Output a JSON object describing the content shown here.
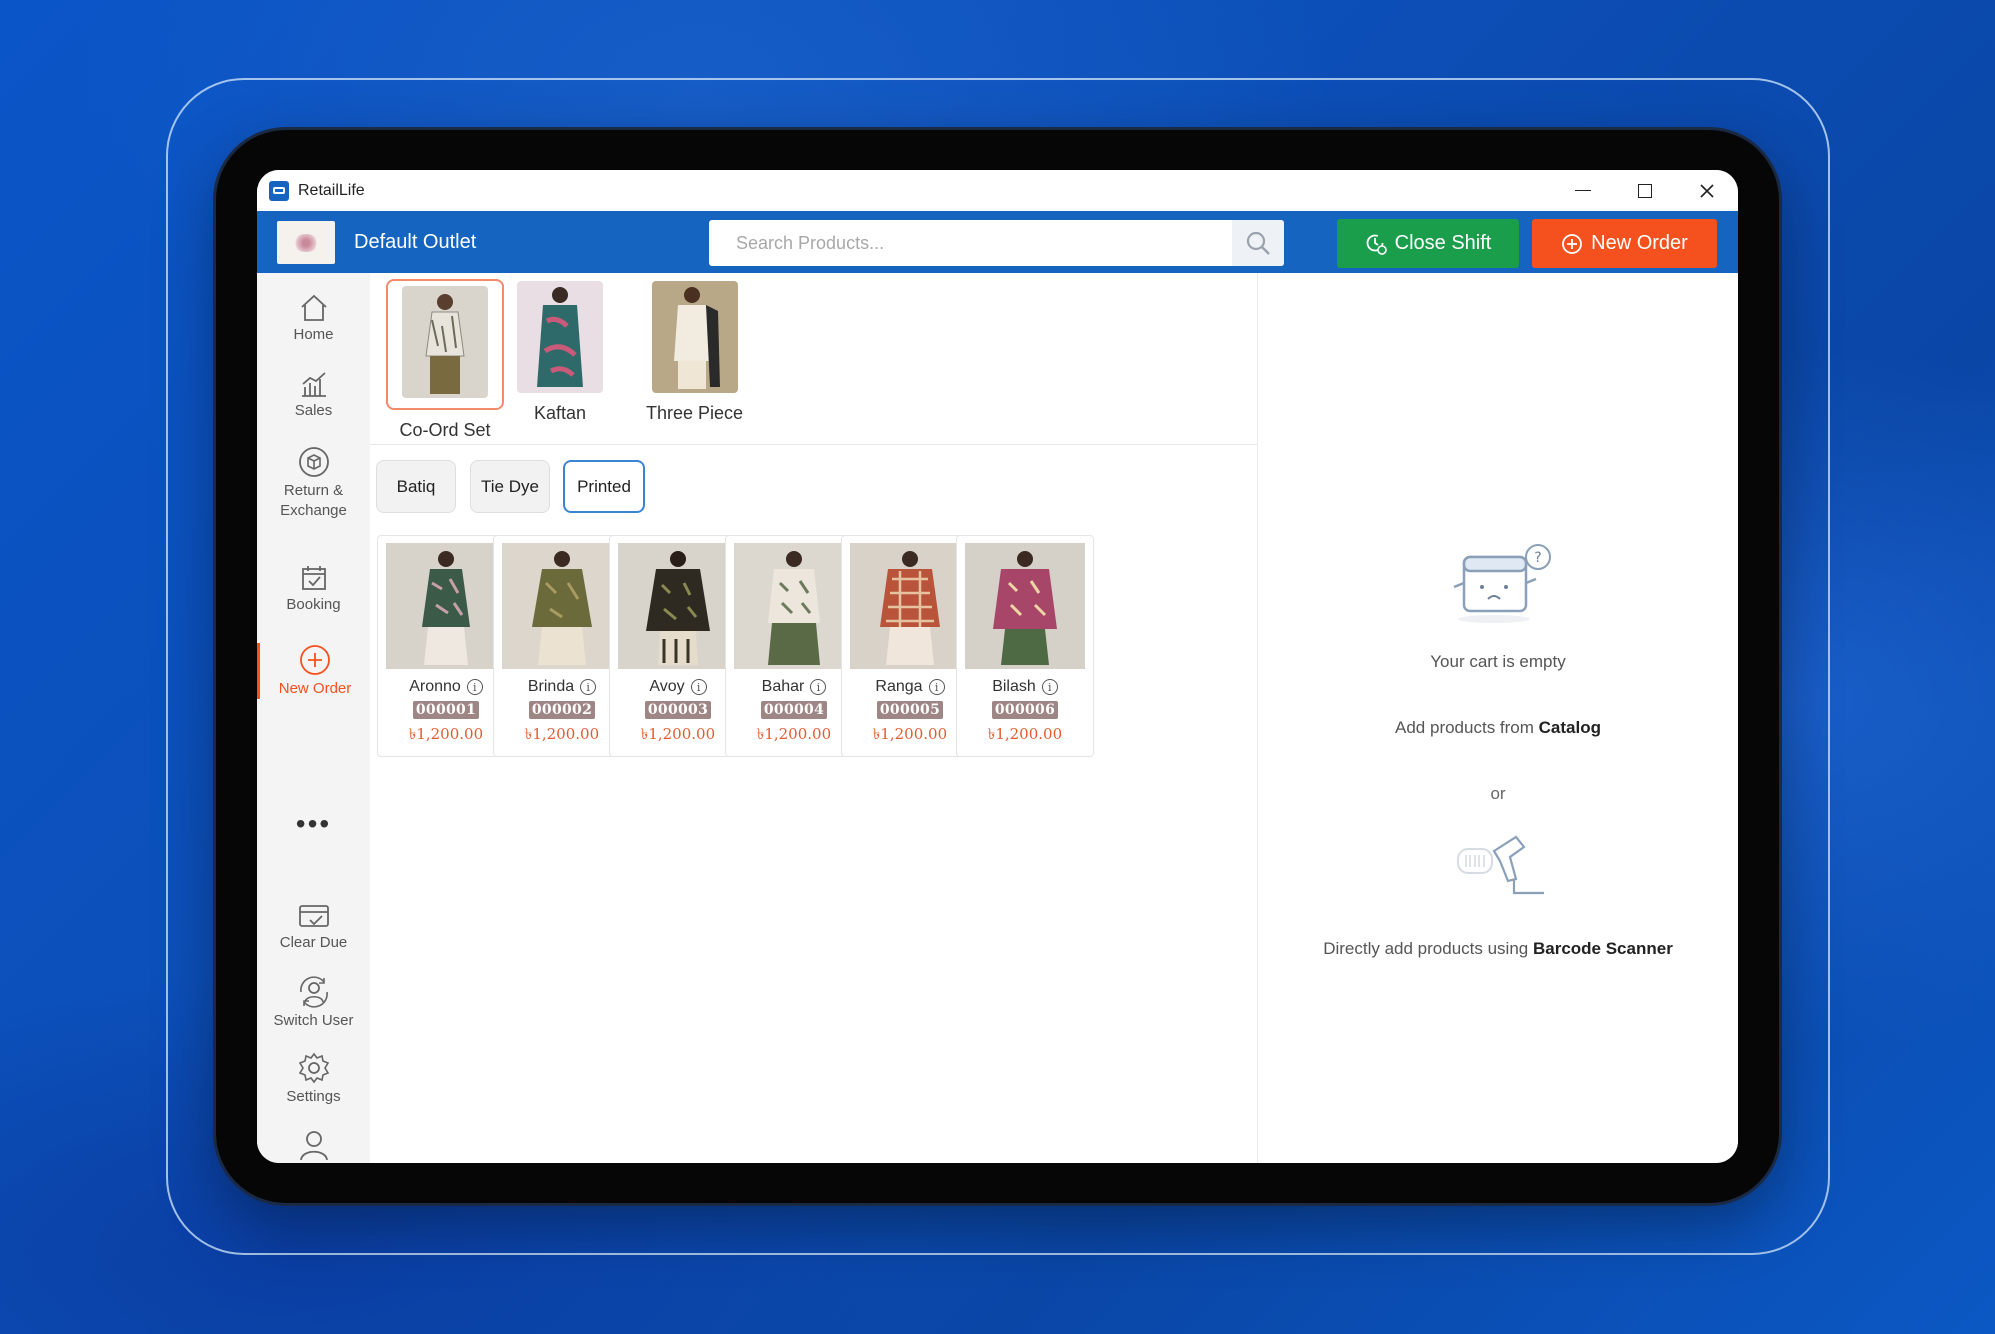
{
  "app": {
    "title": "RetailLife"
  },
  "header": {
    "outlet_name": "Default Outlet",
    "search_placeholder": "Search Products...",
    "close_shift_label": "Close Shift",
    "new_order_label": "New Order",
    "brand_color": "#1565c0",
    "close_shift_color": "#1a9e4b",
    "new_order_color": "#f4511e"
  },
  "sidebar": {
    "items": [
      {
        "label": "Home",
        "icon": "home-icon"
      },
      {
        "label": "Sales",
        "icon": "sales-chart-icon"
      },
      {
        "label": "Return & Exchange",
        "icon": "return-exchange-icon"
      },
      {
        "label": "Booking",
        "icon": "calendar-check-icon"
      },
      {
        "label": "New Order",
        "icon": "plus-circle-icon",
        "active": true
      },
      {
        "label": "Clear Due",
        "icon": "card-check-icon"
      },
      {
        "label": "Switch User",
        "icon": "switch-user-icon"
      },
      {
        "label": "Settings",
        "icon": "gear-icon"
      },
      {
        "label": "",
        "icon": "user-icon"
      }
    ],
    "more_label": "•••"
  },
  "categories": [
    {
      "label": "Co-Ord Set",
      "active": true
    },
    {
      "label": "Kaftan",
      "active": false
    },
    {
      "label": "Three Piece",
      "active": false
    }
  ],
  "subcategories": [
    {
      "label": "Batiq",
      "active": false
    },
    {
      "label": "Tie Dye",
      "active": false
    },
    {
      "label": "Printed",
      "active": true
    }
  ],
  "products": [
    {
      "name": "Aronno",
      "code": "000001",
      "price": "৳1,200.00"
    },
    {
      "name": "Brinda",
      "code": "000002",
      "price": "৳1,200.00"
    },
    {
      "name": "Avoy",
      "code": "000003",
      "price": "৳1,200.00"
    },
    {
      "name": "Bahar",
      "code": "000004",
      "price": "৳1,200.00"
    },
    {
      "name": "Ranga",
      "code": "000005",
      "price": "৳1,200.00"
    },
    {
      "name": "Bilash",
      "code": "000006",
      "price": "৳1,200.00"
    }
  ],
  "cart": {
    "empty_title": "Your cart is empty",
    "add_from_prefix": "Add products from ",
    "add_from_bold": "Catalog",
    "or_label": "or",
    "barcode_prefix": "Directly add products using ",
    "barcode_bold": "Barcode Scanner"
  }
}
